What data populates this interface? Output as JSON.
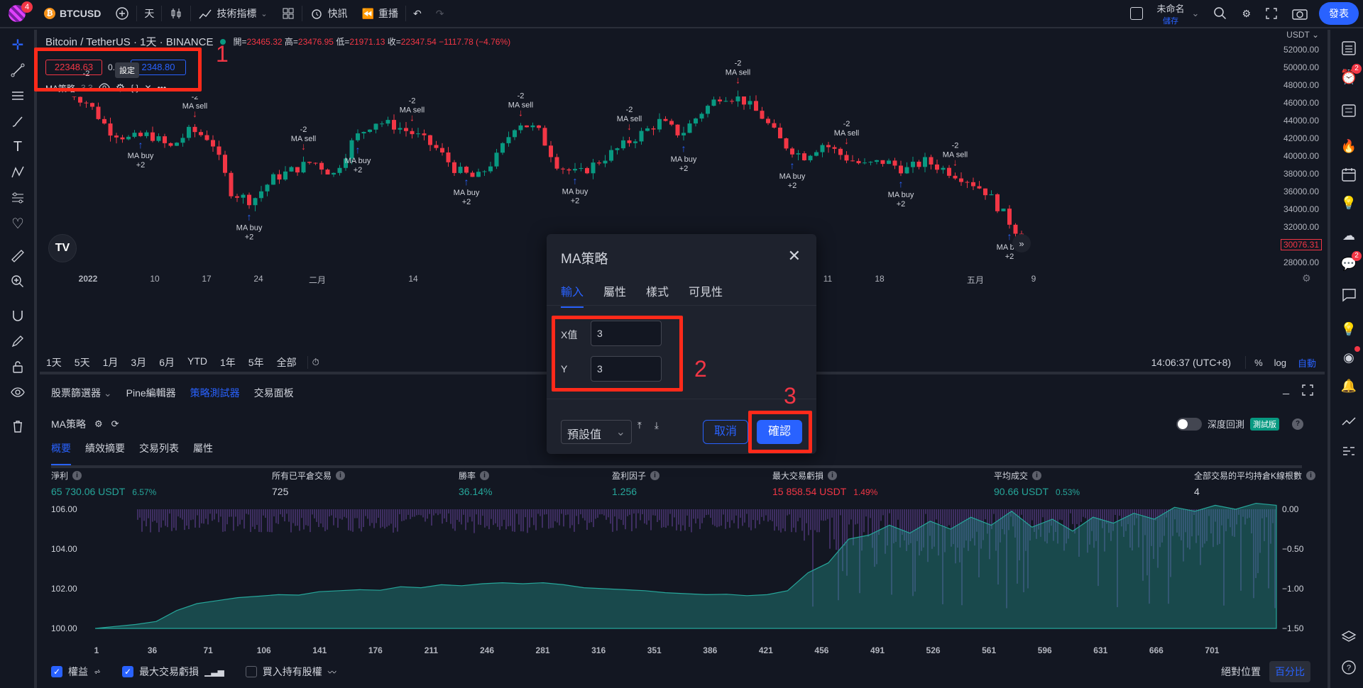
{
  "topbar": {
    "symbol": "BTCUSD",
    "notif_count": "4",
    "interval": "天",
    "indicators": "技術指標",
    "alerts": "快訊",
    "replay": "重播",
    "layout_name": "未命名",
    "layout_sub": "儲存",
    "publish": "發表"
  },
  "chart": {
    "title": "Bitcoin / TetherUS · 1天 · BINANCE",
    "ohlc": {
      "o_label": "開=",
      "o": "23465.32",
      "h_label": "高=",
      "h": "23476.95",
      "l_label": "低=",
      "l": "21971.13",
      "c_label": "收=",
      "c": "22347.54",
      "chg": "−1117.78 (−4.76%)"
    },
    "sell_price": "22348.63",
    "spread": "0.",
    "buy_price": "2348.80",
    "tooltip": "設定",
    "indicator_name": "MA策略",
    "indicator_params": "3 3",
    "currency": "USDT",
    "price_labels": [
      "52000.00",
      "50000.00",
      "48000.00",
      "46000.00",
      "44000.00",
      "42000.00",
      "40000.00",
      "38000.00",
      "36000.00",
      "34000.00",
      "32000.00",
      "30076.31",
      "28000.00"
    ],
    "time_labels": [
      "2022",
      "10",
      "17",
      "24",
      "二月",
      "14",
      "21",
      "四月",
      "11",
      "18",
      "五月",
      "9"
    ],
    "signal_sell": "MA sell",
    "signal_sell_qty": "-2",
    "signal_buy": "MA buy",
    "signal_buy_qty": "+2",
    "annotations": [
      "1",
      "2",
      "3"
    ]
  },
  "rangebar": {
    "ranges": [
      "1天",
      "5天",
      "1月",
      "3月",
      "6月",
      "YTD",
      "1年",
      "5年",
      "全部"
    ],
    "time": "14:06:37 (UTC+8)",
    "pct": "%",
    "log": "log",
    "auto": "自動"
  },
  "panel": {
    "tabs": [
      "股票篩選器",
      "Pine編輯器",
      "策略測試器",
      "交易面板"
    ],
    "strategy": "MA策略",
    "deep_backtest": "深度回測",
    "beta": "測試版",
    "subtabs": [
      "概要",
      "績效摘要",
      "交易列表",
      "屬性"
    ],
    "metrics": [
      {
        "label": "淨利",
        "value": "65 730.06 USDT",
        "pct": "6.57%",
        "color": "#26a69a"
      },
      {
        "label": "所有已平倉交易",
        "value": "725",
        "pct": "",
        "color": "#d1d4dc"
      },
      {
        "label": "勝率",
        "value": "36.14%",
        "pct": "",
        "color": "#26a69a"
      },
      {
        "label": "盈利因子",
        "value": "1.256",
        "pct": "",
        "color": "#26a69a"
      },
      {
        "label": "最大交易虧損",
        "value": "15 858.54 USDT",
        "pct": "1.49%",
        "color": "#f23645"
      },
      {
        "label": "平均成交",
        "value": "90.66 USDT",
        "pct": "0.53%",
        "color": "#26a69a"
      },
      {
        "label": "全部交易的平均持倉K線根數",
        "value": "4",
        "pct": "",
        "color": "#d1d4dc"
      }
    ],
    "y_left": [
      "106.00",
      "104.00",
      "102.00",
      "100.00"
    ],
    "y_right": [
      "0.00",
      "−0.50",
      "−1.00",
      "−1.50"
    ],
    "x_ticks": [
      "1",
      "36",
      "71",
      "106",
      "141",
      "176",
      "211",
      "246",
      "281",
      "316",
      "351",
      "386",
      "421",
      "456",
      "491",
      "526",
      "561",
      "596",
      "631",
      "666",
      "701"
    ],
    "legend": [
      {
        "label": "權益",
        "checked": true
      },
      {
        "label": "最大交易虧損",
        "checked": true
      },
      {
        "label": "買入持有股權",
        "checked": false
      }
    ],
    "abs_pos": "絕對位置",
    "pct_btn": "百分比",
    "equity": [
      0,
      0.1,
      0.2,
      0.35,
      0.9,
      1.25,
      1.4,
      1.55,
      1.62,
      1.7,
      1.68,
      1.85,
      1.9,
      1.95,
      1.92,
      2.1,
      2.05,
      2.2,
      2.15,
      2.25,
      2.3,
      2.25,
      2.3,
      2.2,
      2.05,
      2.0,
      1.95,
      1.9,
      1.8,
      1.75,
      1.7,
      1.72,
      1.65,
      1.7,
      1.9,
      2.8,
      3.3,
      4.5,
      4.7,
      5.2,
      4.8,
      5.4,
      5.0,
      5.6,
      5.2,
      5.9,
      5.1,
      5.5,
      4.9,
      5.6,
      5.3,
      5.8,
      5.5,
      6.1,
      5.9,
      6.2,
      6.0,
      6.3,
      6.2
    ]
  },
  "dialog": {
    "title": "MA策略",
    "tabs": [
      "輸入",
      "屬性",
      "樣式",
      "可見性"
    ],
    "x_label": "X值",
    "x_value": "3",
    "y_label": "Y",
    "y_value": "3",
    "preset": "預設值",
    "cancel": "取消",
    "ok": "確認"
  }
}
